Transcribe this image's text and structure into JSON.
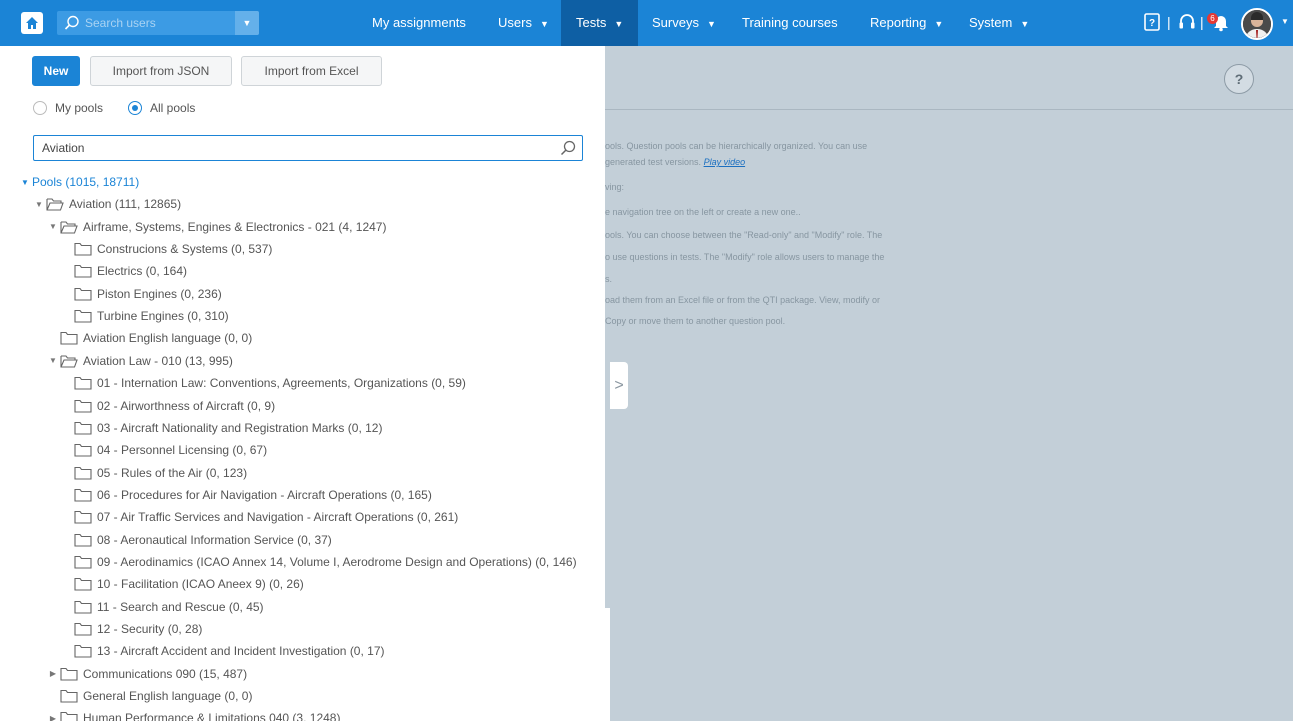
{
  "nav": {
    "search_placeholder": "Search users",
    "items": [
      {
        "label": "My assignments",
        "has_caret": false,
        "active": false
      },
      {
        "label": "Users",
        "has_caret": true,
        "active": false
      },
      {
        "label": "Tests",
        "has_caret": true,
        "active": true
      },
      {
        "label": "Surveys",
        "has_caret": true,
        "active": false
      },
      {
        "label": "Training courses",
        "has_caret": false,
        "active": false
      },
      {
        "label": "Reporting",
        "has_caret": true,
        "active": false
      },
      {
        "label": "System",
        "has_caret": true,
        "active": false
      }
    ],
    "notification_count": "6",
    "icons": [
      "home-icon",
      "search-icon",
      "question-book-icon",
      "headset-icon",
      "bell-icon",
      "avatar"
    ]
  },
  "toolbar": {
    "new_label": "New",
    "import_json_label": "Import from JSON",
    "import_excel_label": "Import from Excel"
  },
  "scope": {
    "my_pools_label": "My pools",
    "all_pools_label": "All pools",
    "selected": "All pools"
  },
  "filter": {
    "value": "Aviation"
  },
  "tree": [
    {
      "label": "Pools (1015, 18711)",
      "depth": 0,
      "toggle": "open",
      "folder": "none",
      "root": true
    },
    {
      "label": "Aviation (111, 12865)",
      "depth": 1,
      "toggle": "open",
      "folder": "open"
    },
    {
      "label": "Airframe, Systems, Engines & Electronics - 021 (4, 1247)",
      "depth": 2,
      "toggle": "open",
      "folder": "open"
    },
    {
      "label": "Construcions & Systems (0, 537)",
      "depth": 3,
      "toggle": "none",
      "folder": "closed"
    },
    {
      "label": "Electrics (0, 164)",
      "depth": 3,
      "toggle": "none",
      "folder": "closed"
    },
    {
      "label": "Piston Engines (0, 236)",
      "depth": 3,
      "toggle": "none",
      "folder": "closed"
    },
    {
      "label": "Turbine Engines (0, 310)",
      "depth": 3,
      "toggle": "none",
      "folder": "closed"
    },
    {
      "label": "Aviation English language (0, 0)",
      "depth": 2,
      "toggle": "none",
      "folder": "closed"
    },
    {
      "label": "Aviation Law - 010 (13, 995)",
      "depth": 2,
      "toggle": "open",
      "folder": "open"
    },
    {
      "label": "01 - Internation Law: Conventions, Agreements, Organizations (0, 59)",
      "depth": 3,
      "toggle": "none",
      "folder": "closed"
    },
    {
      "label": "02 - Airworthness of Aircraft (0, 9)",
      "depth": 3,
      "toggle": "none",
      "folder": "closed"
    },
    {
      "label": "03 - Aircraft Nationality and Registration Marks (0, 12)",
      "depth": 3,
      "toggle": "none",
      "folder": "closed"
    },
    {
      "label": "04 - Personnel Licensing (0, 67)",
      "depth": 3,
      "toggle": "none",
      "folder": "closed"
    },
    {
      "label": "05 - Rules of the Air (0, 123)",
      "depth": 3,
      "toggle": "none",
      "folder": "closed"
    },
    {
      "label": "06 - Procedures for Air Navigation - Aircraft Operations (0, 165)",
      "depth": 3,
      "toggle": "none",
      "folder": "closed"
    },
    {
      "label": "07 - Air Traffic Services and Navigation - Aircraft Operations (0, 261)",
      "depth": 3,
      "toggle": "none",
      "folder": "closed"
    },
    {
      "label": "08 - Aeronautical Information Service (0, 37)",
      "depth": 3,
      "toggle": "none",
      "folder": "closed"
    },
    {
      "label": "09 - Aerodinamics (ICAO Annex 14, Volume I, Aerodrome Design and Operations) (0, 146)",
      "depth": 3,
      "toggle": "none",
      "folder": "closed"
    },
    {
      "label": "10 - Facilitation (ICAO Aneex 9) (0, 26)",
      "depth": 3,
      "toggle": "none",
      "folder": "closed"
    },
    {
      "label": "11 - Search and Rescue (0, 45)",
      "depth": 3,
      "toggle": "none",
      "folder": "closed"
    },
    {
      "label": "12 - Security (0, 28)",
      "depth": 3,
      "toggle": "none",
      "folder": "closed"
    },
    {
      "label": "13 - Aircraft Accident and Incident Investigation (0, 17)",
      "depth": 3,
      "toggle": "none",
      "folder": "closed"
    },
    {
      "label": "Communications 090 (15, 487)",
      "depth": 2,
      "toggle": "closed",
      "folder": "closed"
    },
    {
      "label": "General English language (0, 0)",
      "depth": 2,
      "toggle": "none",
      "folder": "closed"
    },
    {
      "label": "Human Performance & Limitations 040 (3, 1248)",
      "depth": 2,
      "toggle": "closed",
      "folder": "closed"
    }
  ],
  "background": {
    "help_label": "?",
    "lines": [
      {
        "text": "ools. Question pools can be hierarchically organized. You can use",
        "link": ""
      },
      {
        "text": "generated test versions. ",
        "link": "Play video"
      },
      {
        "text": "ving:",
        "link": ""
      },
      {
        "text": "e navigation tree on the left or create a new one..",
        "link": ""
      },
      {
        "text": "ools. You can choose between the \"Read-only\" and \"Modify\" role. The",
        "link": ""
      },
      {
        "text": "o use questions in tests. The \"Modify\" role allows users to manage the",
        "link": ""
      },
      {
        "text": "s.",
        "link": ""
      },
      {
        "text": "oad them from an Excel file or from the QTI package. View, modify or",
        "link": ""
      },
      {
        "text": "Copy or move them to another question pool.",
        "link": ""
      }
    ],
    "collapse_handle": ">"
  },
  "colors": {
    "brand": "#1b84d6",
    "active_nav": "#0e5fa4",
    "badge": "#e53935"
  }
}
